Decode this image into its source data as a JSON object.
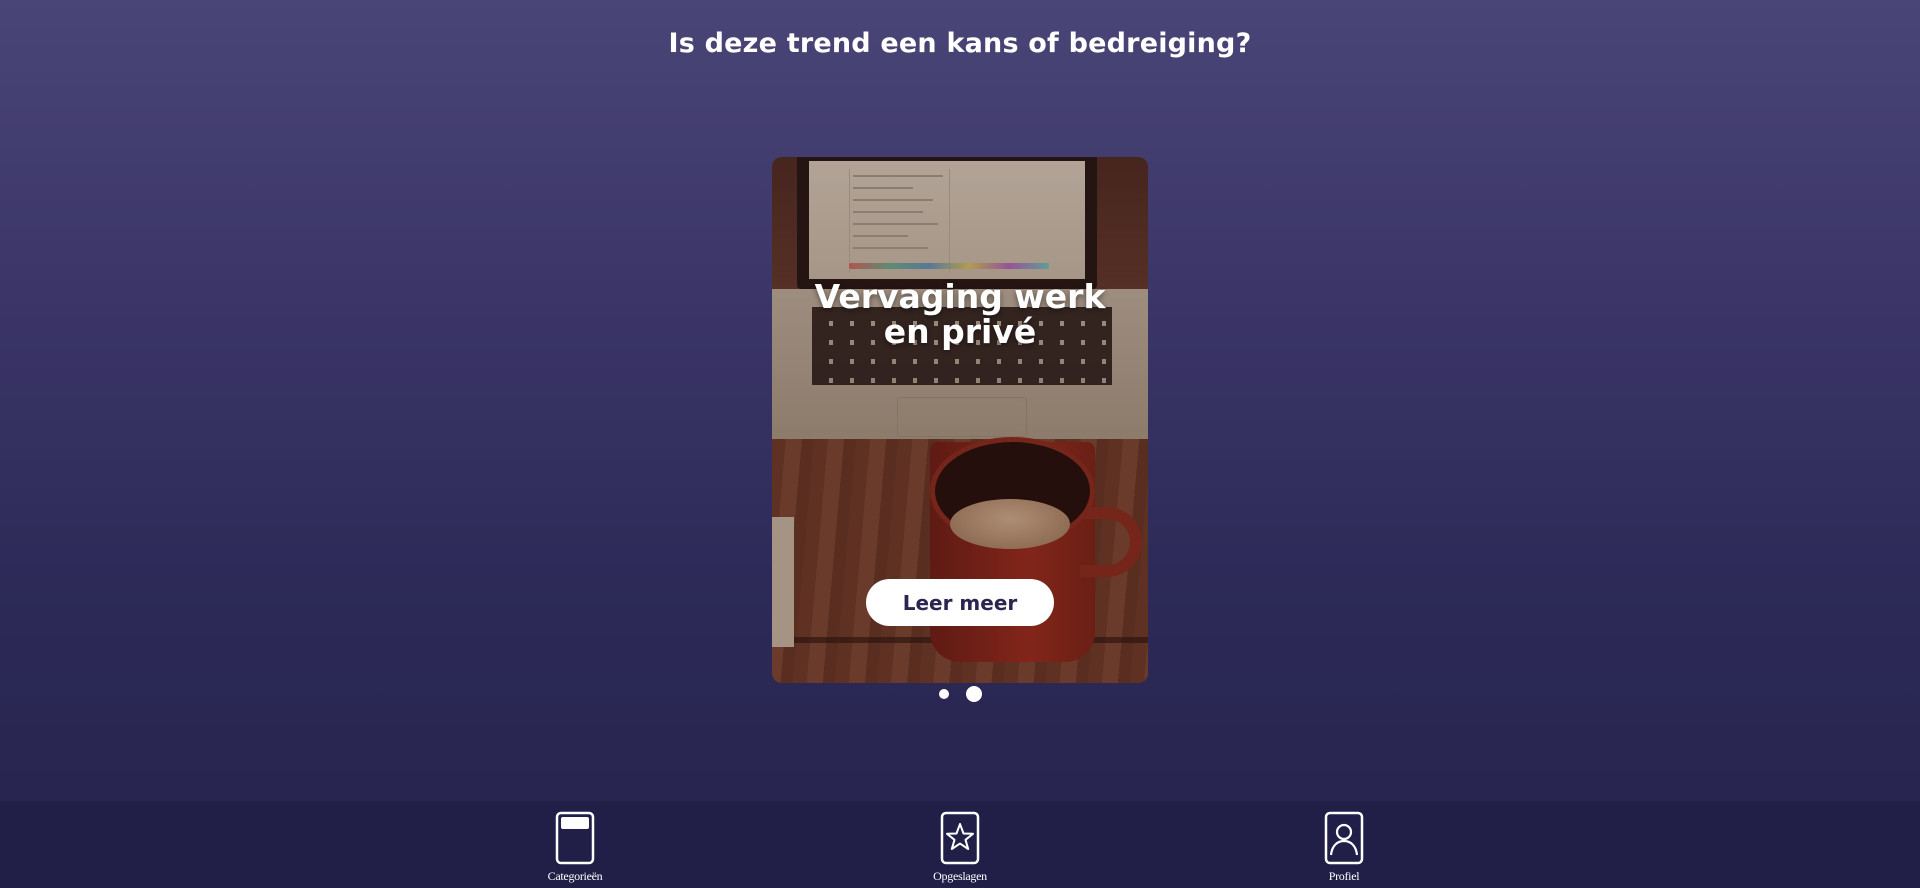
{
  "question": "Is deze trend een kans of bedreiging?",
  "card": {
    "title": "Vervaging werk en privé",
    "button_label": "Leer meer",
    "image": "laptop-and-coffee-mug-photo"
  },
  "pagination": {
    "total": 2,
    "active_index": 1
  },
  "nav": {
    "items": [
      {
        "label": "Categorieën",
        "icon": "categories-icon"
      },
      {
        "label": "Opgeslagen",
        "icon": "star-icon"
      },
      {
        "label": "Profiel",
        "icon": "profile-icon"
      }
    ]
  },
  "colors": {
    "background_top": "#4a4577",
    "background_bottom": "#26234d",
    "nav_background": "#211f47",
    "button_text": "#2a2650"
  }
}
